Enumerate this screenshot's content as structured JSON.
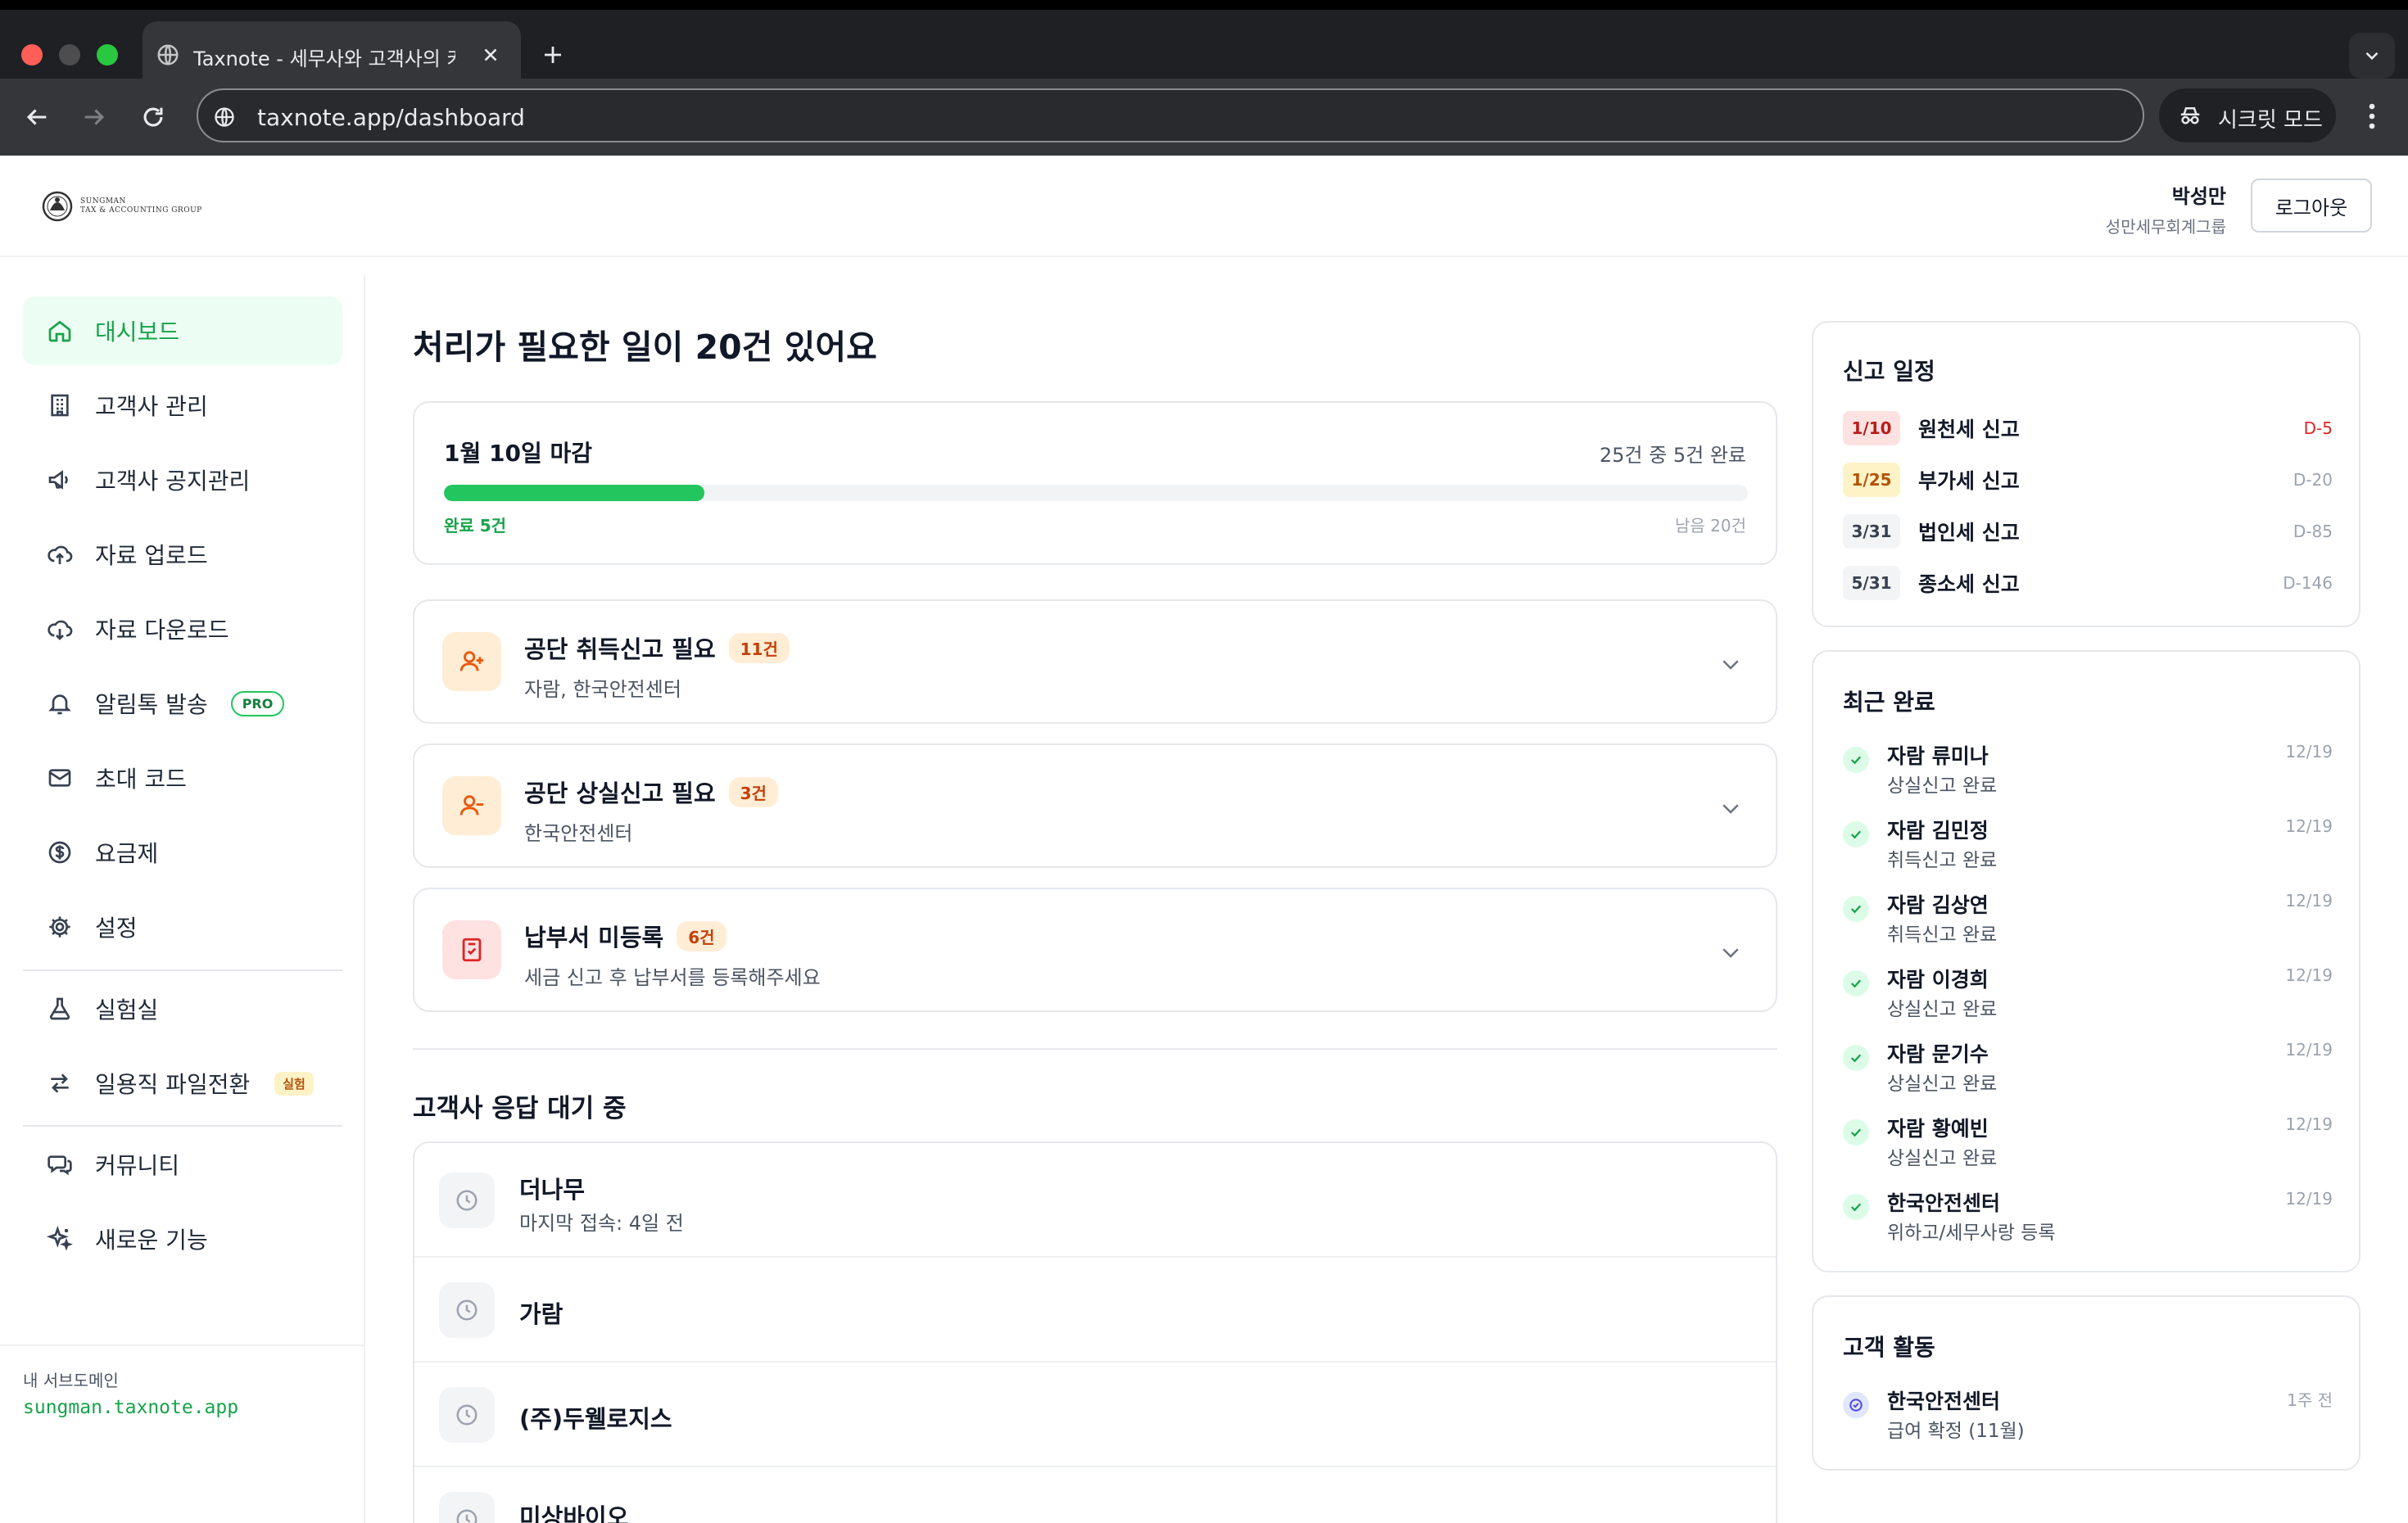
{
  "browser": {
    "tab_title": "Taxnote - 세무사와 고객사의 커뮤",
    "url": "taxnote.app/dashboard",
    "incognito_label": "시크릿 모드"
  },
  "header": {
    "logo_line1": "SUNGMAN",
    "logo_line2": "TAX & ACCOUNTING GROUP",
    "user_name": "박성만",
    "user_org": "성만세무회계그룹",
    "logout_label": "로그아웃"
  },
  "sidebar": {
    "items": [
      {
        "label": "대시보드",
        "icon": "home-icon",
        "active": true
      },
      {
        "label": "고객사 관리",
        "icon": "building-icon"
      },
      {
        "label": "고객사 공지관리",
        "icon": "megaphone-icon"
      },
      {
        "label": "자료 업로드",
        "icon": "cloud-upload-icon"
      },
      {
        "label": "자료 다운로드",
        "icon": "cloud-download-icon"
      },
      {
        "label": "알림톡 발송",
        "icon": "bell-icon",
        "badge": "PRO"
      },
      {
        "label": "초대 코드",
        "icon": "mail-icon"
      },
      {
        "label": "요금제",
        "icon": "dollar-icon"
      },
      {
        "label": "설정",
        "icon": "gear-icon"
      },
      {
        "label": "실험실",
        "icon": "flask-icon"
      },
      {
        "label": "일용직 파일전환",
        "icon": "swap-icon",
        "badge": "실험"
      },
      {
        "label": "커뮤니티",
        "icon": "chat-icon"
      },
      {
        "label": "새로운 기능",
        "icon": "sparkles-icon"
      }
    ],
    "subdomain_label": "내 서브도메인",
    "subdomain_value": "sungman.taxnote.app"
  },
  "main": {
    "title": "처리가 필요한 일이 20건 있어요",
    "deadline": {
      "title": "1월 10일 마감",
      "count_text": "25건 중 5건 완료",
      "progress_fraction": 0.2,
      "done_text": "완료 5건",
      "remaining_text": "남음 20건"
    },
    "tasks": [
      {
        "title": "공단 취득신고 필요",
        "badge": "11건",
        "sub": "자람, 한국안전센터",
        "icon": "user-plus-icon"
      },
      {
        "title": "공단 상실신고 필요",
        "badge": "3건",
        "sub": "한국안전센터",
        "icon": "user-minus-icon"
      },
      {
        "title": "납부서 미등록",
        "badge": "6건",
        "sub": "세금 신고 후 납부서를 등록해주세요",
        "icon": "receipt-icon"
      }
    ],
    "waiting_title": "고객사 응답 대기 중",
    "waiting": [
      {
        "name": "더나무",
        "sub": "마지막 접속: 4일 전"
      },
      {
        "name": "가람",
        "sub": ""
      },
      {
        "name": "(주)두웰로지스",
        "sub": ""
      },
      {
        "name": "미상바이오",
        "sub": ""
      }
    ]
  },
  "right": {
    "schedule_title": "신고 일정",
    "schedule": [
      {
        "date": "1/10",
        "name": "원천세 신고",
        "dday": "D-5",
        "tone": "red"
      },
      {
        "date": "1/25",
        "name": "부가세 신고",
        "dday": "D-20",
        "tone": "amber"
      },
      {
        "date": "3/31",
        "name": "법인세 신고",
        "dday": "D-85",
        "tone": "gray"
      },
      {
        "date": "5/31",
        "name": "종소세 신고",
        "dday": "D-146",
        "tone": "gray"
      }
    ],
    "recent_title": "최근 완료",
    "recent": [
      {
        "name": "자람 류미나",
        "sub": "상실신고 완료",
        "date": "12/19"
      },
      {
        "name": "자람 김민정",
        "sub": "취득신고 완료",
        "date": "12/19"
      },
      {
        "name": "자람 김상연",
        "sub": "취득신고 완료",
        "date": "12/19"
      },
      {
        "name": "자람 이경희",
        "sub": "상실신고 완료",
        "date": "12/19"
      },
      {
        "name": "자람 문기수",
        "sub": "상실신고 완료",
        "date": "12/19"
      },
      {
        "name": "자람 황예빈",
        "sub": "상실신고 완료",
        "date": "12/19"
      },
      {
        "name": "한국안전센터",
        "sub": "위하고/세무사랑 등록",
        "date": "12/19"
      }
    ],
    "activity_title": "고객 활동",
    "activity": [
      {
        "name": "한국안전센터",
        "sub": "급여 확정 (11월)",
        "date": "1주 전"
      }
    ]
  },
  "colors": {
    "accent": "#22c55e",
    "accent_text": "#16a34a",
    "warning": "#c2410c",
    "danger": "#dc2626"
  }
}
